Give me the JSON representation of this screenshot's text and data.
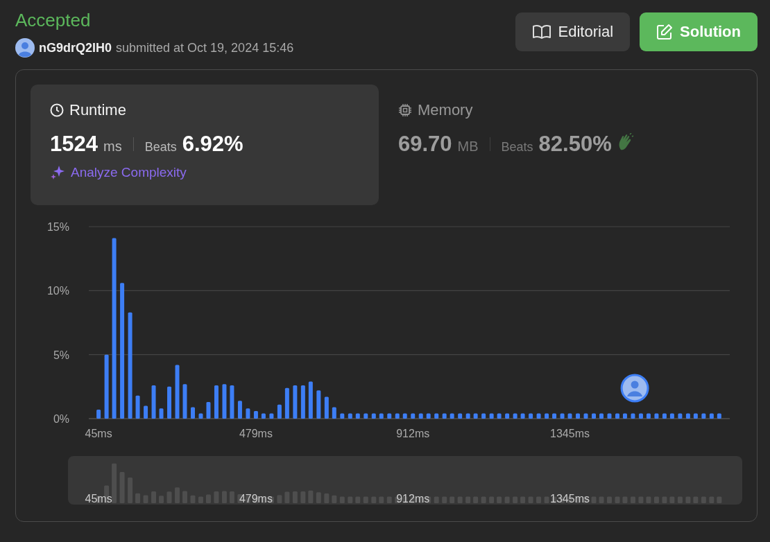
{
  "status": "Accepted",
  "submission": {
    "user": "nG9drQ2IH0",
    "submitted_text": "submitted at Oct 19, 2024 15:46"
  },
  "buttons": [
    {
      "kind": "editorial",
      "label": "Editorial"
    },
    {
      "kind": "solution",
      "label": "Solution"
    }
  ],
  "metrics": [
    {
      "kind": "runtime",
      "title": "Runtime",
      "selected": true,
      "value": "1524",
      "unit": "ms",
      "beats_label": "Beats",
      "beats": "6.92%",
      "action": "Analyze Complexity"
    },
    {
      "kind": "memory",
      "title": "Memory",
      "selected": false,
      "value": "69.70",
      "unit": "MB",
      "beats_label": "Beats",
      "beats": "82.50%"
    }
  ],
  "distribution": {
    "chart_data": {
      "type": "bar",
      "x": [
        45,
        67,
        88,
        110,
        132,
        153,
        175,
        197,
        218,
        240,
        262,
        283,
        305,
        327,
        348,
        370,
        392,
        413,
        435,
        457,
        479,
        500,
        522,
        544,
        565,
        587,
        609,
        630,
        652,
        674,
        695,
        717,
        739,
        760,
        782,
        804,
        825,
        847,
        869,
        890,
        912,
        934,
        955,
        977,
        999,
        1020,
        1042,
        1064,
        1085,
        1107,
        1129,
        1150,
        1172,
        1194,
        1215,
        1237,
        1259,
        1281,
        1302,
        1324,
        1345,
        1367,
        1389,
        1411,
        1432,
        1454,
        1476,
        1497,
        1519,
        1541,
        1562,
        1584,
        1606,
        1627,
        1649,
        1671,
        1692,
        1714,
        1736,
        1757
      ],
      "values": [
        0.7,
        5.0,
        14.1,
        10.6,
        8.3,
        1.8,
        1.0,
        2.6,
        0.8,
        2.5,
        4.2,
        2.7,
        0.9,
        0.4,
        1.3,
        2.6,
        2.7,
        2.6,
        1.4,
        0.8,
        0.6,
        0.4,
        0.4,
        1.1,
        2.4,
        2.6,
        2.6,
        2.9,
        2.2,
        1.7,
        0.9,
        0.4,
        0.4,
        0.4,
        0.4,
        0.4,
        0.4,
        0.4,
        0.4,
        0.4,
        0.4,
        0.4,
        0.4,
        0.4,
        0.4,
        0.4,
        0.4,
        0.4,
        0.4,
        0.4,
        0.4,
        0.4,
        0.4,
        0.4,
        0.4,
        0.4,
        0.4,
        0.4,
        0.4,
        0.4,
        0.4,
        0.4,
        0.4,
        0.4,
        0.4,
        0.4,
        0.4,
        0.4,
        0.4,
        0.4,
        0.4,
        0.4,
        0.4,
        0.4,
        0.4,
        0.4,
        0.4,
        0.4,
        0.4,
        0.4
      ],
      "xlim": [
        18,
        1786
      ],
      "ylim": [
        0,
        15
      ],
      "yticks": [
        {
          "value": 0,
          "label": "0%"
        },
        {
          "value": 5,
          "label": "5%"
        },
        {
          "value": 10,
          "label": "10%"
        },
        {
          "value": 15,
          "label": "15%"
        }
      ],
      "xticks": [
        {
          "value": 45,
          "label": "45ms"
        },
        {
          "value": 479,
          "label": "479ms"
        },
        {
          "value": 912,
          "label": "912ms"
        },
        {
          "value": 1345,
          "label": "1345ms"
        }
      ]
    },
    "overview_ticks": [
      "45ms",
      "479ms",
      "912ms",
      "1345ms"
    ]
  }
}
